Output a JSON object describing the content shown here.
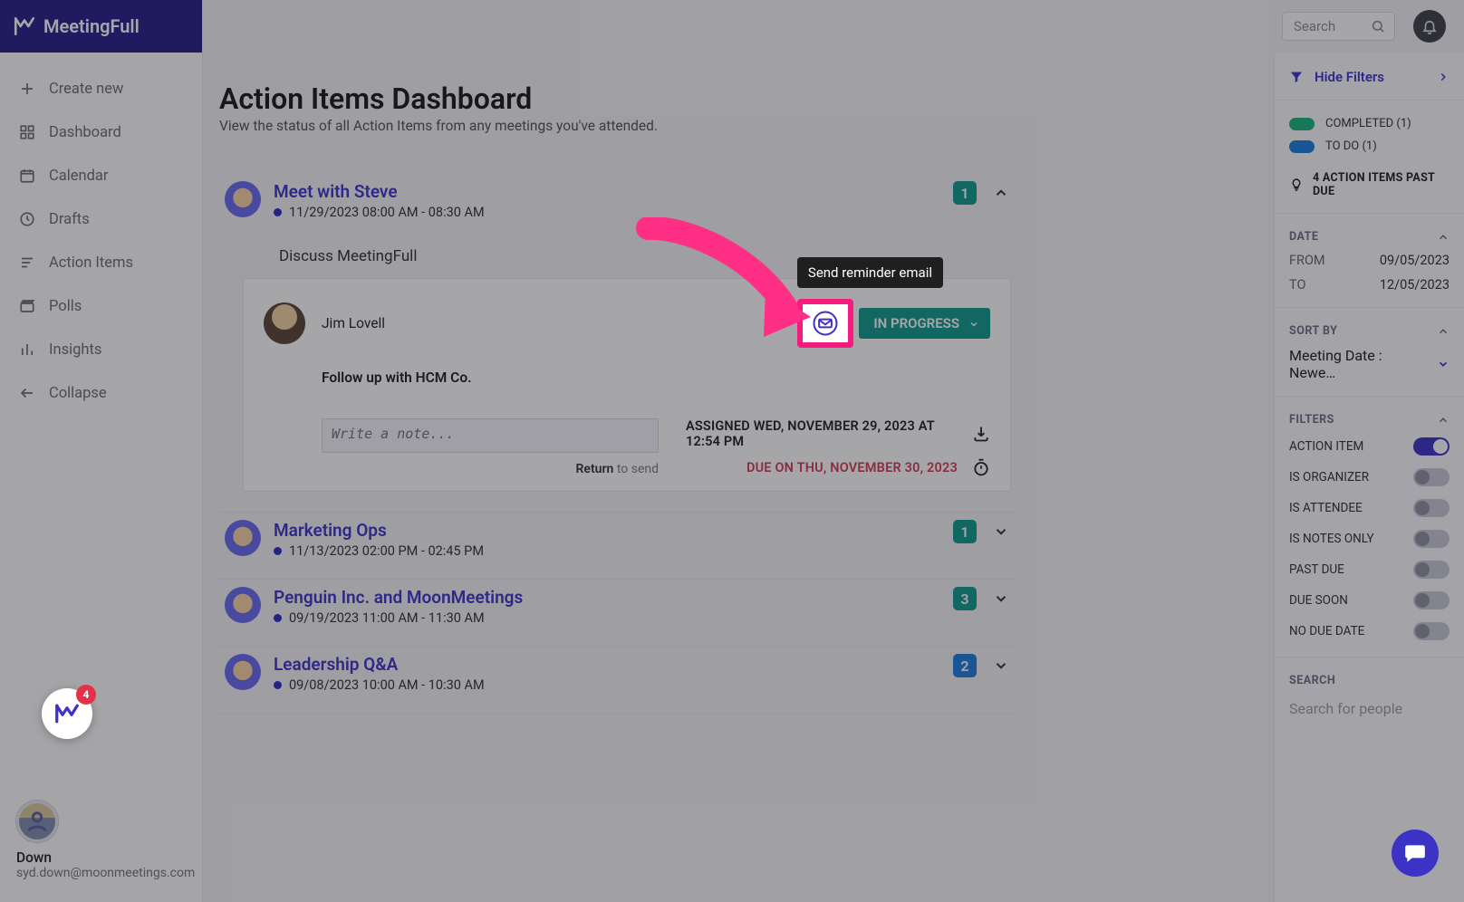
{
  "brand": {
    "name": "MeetingFull"
  },
  "sidebar": {
    "create_label": "Create new",
    "items": [
      {
        "label": "Dashboard"
      },
      {
        "label": "Calendar"
      },
      {
        "label": "Drafts"
      },
      {
        "label": "Action Items"
      },
      {
        "label": "Polls"
      },
      {
        "label": "Insights"
      },
      {
        "label": "Collapse"
      }
    ],
    "user": {
      "name": "Down",
      "email": "syd.down@moonmeetings.com",
      "badge": "4"
    }
  },
  "header": {
    "search_placeholder": "Search"
  },
  "page": {
    "title": "Action Items Dashboard",
    "subtitle": "View the status of all Action Items from any meetings you've attended."
  },
  "meetings": [
    {
      "title": "Meet with Steve",
      "time": "11/29/2023 08:00 AM - 08:30 AM",
      "count": "1",
      "count_color": "chip-green",
      "expanded": true,
      "topic": "Discuss MeetingFull",
      "assignee": "Jim Lovell",
      "task": "Follow up with HCM Co.",
      "note_placeholder": "Write a note...",
      "note_hint_key": "Return",
      "note_hint_rest": " to send",
      "status_label": "IN PROGRESS",
      "tooltip": "Send reminder email",
      "assigned_text": "ASSIGNED WED, NOVEMBER 29, 2023 AT 12:54 PM",
      "due_text": "DUE ON THU, NOVEMBER 30, 2023"
    },
    {
      "title": "Marketing Ops",
      "time": "11/13/2023 02:00 PM - 02:45 PM",
      "count": "1",
      "count_color": "chip-teal",
      "expanded": false
    },
    {
      "title": "Penguin Inc. and MoonMeetings",
      "time": "09/19/2023 11:00 AM - 11:30 AM",
      "count": "3",
      "count_color": "chip-teal",
      "expanded": false
    },
    {
      "title": "Leadership Q&A",
      "time": "09/08/2023 10:00 AM - 10:30 AM",
      "count": "2",
      "count_color": "chip-blue",
      "expanded": false
    }
  ],
  "filters_panel": {
    "hide_label": "Hide Filters",
    "legend": [
      {
        "label": "COMPLETED (1)",
        "swatch": "sw-green"
      },
      {
        "label": "TO DO (1)",
        "swatch": "sw-blue"
      }
    ],
    "past_due_label": "4 ACTION ITEMS PAST DUE",
    "date_section": "DATE",
    "date_from_k": "FROM",
    "date_from_v": "09/05/2023",
    "date_to_k": "TO",
    "date_to_v": "12/05/2023",
    "sort_section": "SORT BY",
    "sort_value": "Meeting Date : Newe…",
    "filters_section": "FILTERS",
    "filter_rows": [
      {
        "label": "ACTION ITEM",
        "on": true
      },
      {
        "label": "IS ORGANIZER",
        "on": false
      },
      {
        "label": "IS ATTENDEE",
        "on": false
      },
      {
        "label": "IS NOTES ONLY",
        "on": false
      },
      {
        "label": "PAST DUE",
        "on": false
      },
      {
        "label": "DUE SOON",
        "on": false
      },
      {
        "label": "NO DUE DATE",
        "on": false
      }
    ],
    "search_section": "SEARCH",
    "search_hint": "Search for people"
  }
}
